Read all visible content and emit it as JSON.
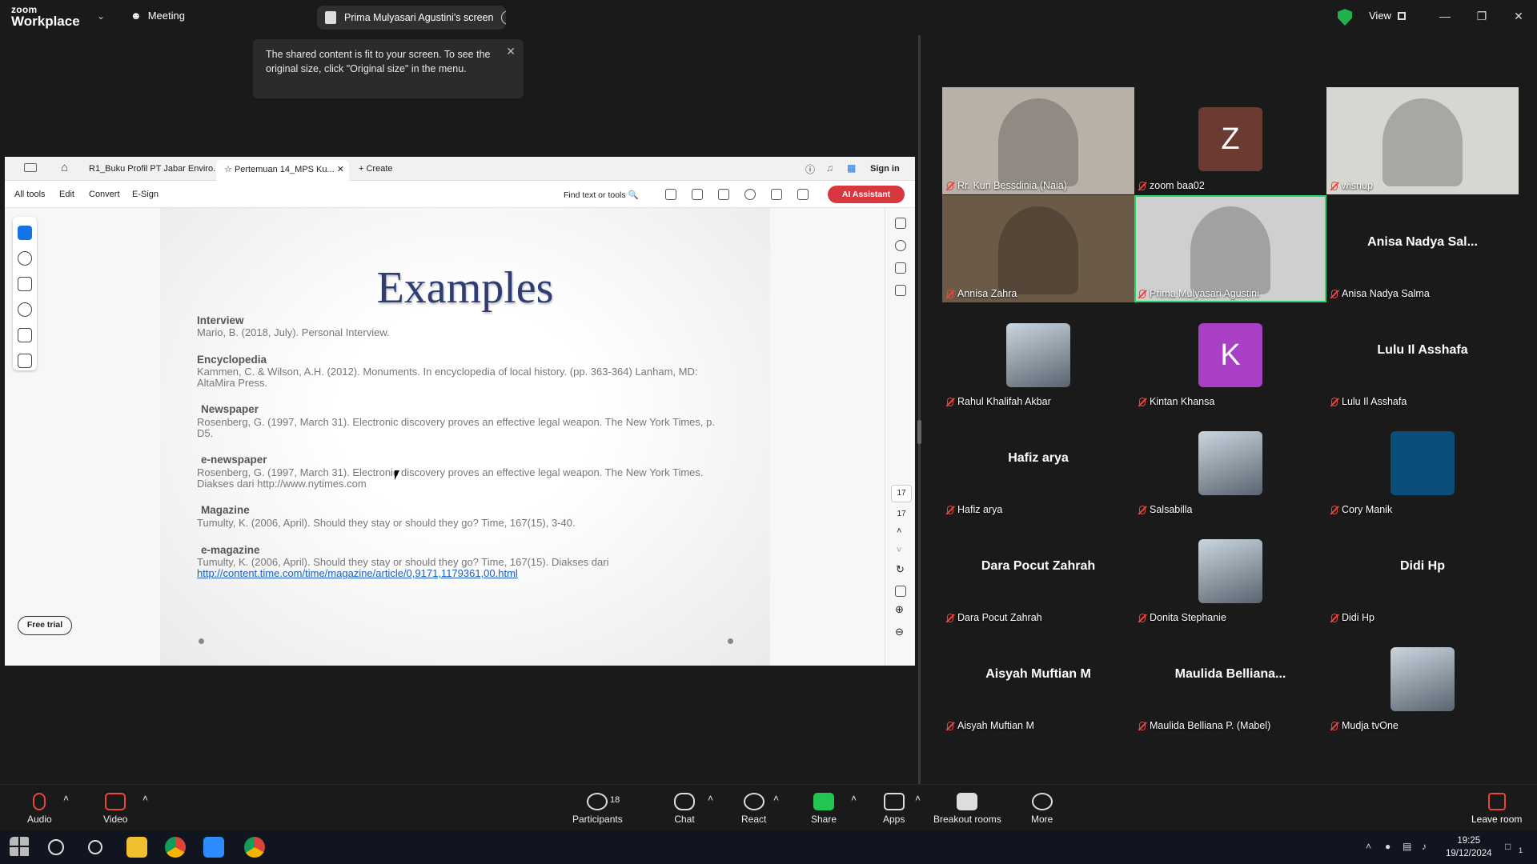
{
  "titlebar": {
    "logo_line1": "zoom",
    "logo_line2": "Workplace",
    "meeting_label": "Meeting",
    "share_pill_label": "Prima Mulyasari Agustini's screen",
    "view_label": "View",
    "colors": {
      "shield": "#22b14c"
    }
  },
  "notice": {
    "text": "The shared content is fit to your screen. To see the original size, click \"Original size\" in the menu."
  },
  "acrobat": {
    "tabs": [
      {
        "label": "R1_Buku Profil PT Jabar Enviro..."
      },
      {
        "label": "Pertemuan 14_MPS Ku..."
      }
    ],
    "create_label": "Create",
    "signin_label": "Sign in",
    "menu": [
      "All tools",
      "Edit",
      "Convert",
      "E-Sign"
    ],
    "find_label": "Find text or tools",
    "ai_label": "AI Assistant",
    "free_trial_label": "Free trial",
    "page_current": "17",
    "page_total": "17",
    "colors": {
      "ai_button": "#d7373f",
      "active_tool": "#1473e6"
    }
  },
  "slide": {
    "title": "Examples",
    "refs": [
      {
        "heading": "Interview",
        "body": "Mario, B. (2018, July). Personal Interview."
      },
      {
        "heading": "Encyclopedia",
        "body": "Kammen, C. & Wilson, A.H. (2012). Monuments. In encyclopedia of local history. (pp. 363-364) Lanham, MD: AltaMira Press."
      },
      {
        "heading": "Newspaper",
        "body": "Rosenberg, G. (1997, March 31). Electronic discovery proves an effective legal weapon. The New York Times, p. D5."
      },
      {
        "heading": "e-newspaper",
        "body": "Rosenberg, G. (1997, March 31). Electronic discovery proves an effective legal weapon. The New York Times. Diakses dari http://www.nytimes.com"
      },
      {
        "heading": "Magazine",
        "body": "Tumulty, K. (2006, April). Should they stay or should they go? Time, 167(15), 3-40."
      },
      {
        "heading": "e-magazine",
        "body": "Tumulty, K. (2006, April). Should they stay or should they go? Time, 167(15). Diakses dari",
        "link": "http://content.time.com/time/magazine/article/0,9171,1179361,00.html"
      }
    ]
  },
  "gallery": [
    {
      "name": "Rr. Kun Bessdinia (Naia)",
      "kind": "video"
    },
    {
      "name": "zoom baa02",
      "kind": "letter",
      "letter": "Z",
      "color": "#6b3a30"
    },
    {
      "name": "wisnup",
      "kind": "video"
    },
    {
      "name": "Annisa Zahra",
      "kind": "video"
    },
    {
      "name": "Prima Mulyasari Agustini",
      "kind": "video",
      "active": true
    },
    {
      "name": "Anisa Nadya Salma",
      "kind": "text",
      "display": "Anisa Nadya Sal..."
    },
    {
      "name": "Rahul Khalifah Akbar",
      "kind": "photo"
    },
    {
      "name": "Kintan Khansa",
      "kind": "letter",
      "letter": "K",
      "color": "#a93fc4"
    },
    {
      "name": "Lulu Il Asshafa",
      "kind": "text",
      "display": "Lulu Il Asshafa"
    },
    {
      "name": "Hafiz arya",
      "kind": "text",
      "display": "Hafiz arya"
    },
    {
      "name": "Salsabilla",
      "kind": "photo"
    },
    {
      "name": "Cory Manik",
      "kind": "color",
      "color": "#0a4f7a"
    },
    {
      "name": "Dara Pocut Zahrah",
      "kind": "text",
      "display": "Dara Pocut Zahrah"
    },
    {
      "name": "Donita Stephanie",
      "kind": "photo"
    },
    {
      "name": "Didi Hp",
      "kind": "text",
      "display": "Didi Hp"
    },
    {
      "name": "Aisyah Muftian M",
      "kind": "text",
      "display": "Aisyah Muftian M"
    },
    {
      "name": "Maulida Belliana P. (Mabel)",
      "kind": "text",
      "display": "Maulida  Belliana..."
    },
    {
      "name": "Mudja tvOne",
      "kind": "photo"
    }
  ],
  "controls": {
    "audio": "Audio",
    "video": "Video",
    "participants": "Participants",
    "participant_count": "18",
    "chat": "Chat",
    "react": "React",
    "share": "Share",
    "apps": "Apps",
    "breakout": "Breakout rooms",
    "more": "More",
    "leave": "Leave room",
    "colors": {
      "share": "#23c552",
      "muted": "#e8453c"
    }
  },
  "taskbar": {
    "time": "19:25",
    "date": "19/12/2024",
    "notification_count": "1"
  }
}
